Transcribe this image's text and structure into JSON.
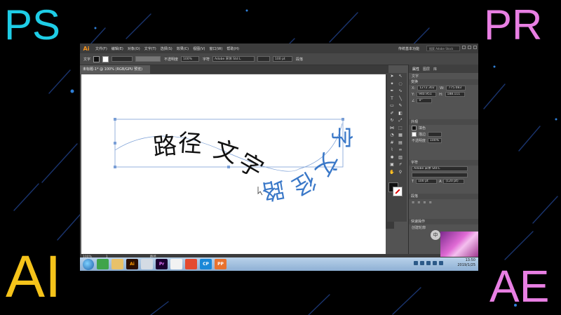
{
  "overlay_labels": {
    "top_left": "PS",
    "top_right": "PR",
    "bottom_left": "AI",
    "bottom_right": "AE"
  },
  "colors": {
    "ps": "#1ecde6",
    "pr": "#e87fe3",
    "ai": "#f5c31a",
    "ae": "#e87fe3",
    "path_text_blue": "#3a78c8"
  },
  "window": {
    "app_logo": "Ai",
    "menus": [
      "文件(F)",
      "编辑(E)",
      "对象(O)",
      "文字(T)",
      "选择(S)",
      "效果(C)",
      "视图(V)",
      "窗口(W)",
      "帮助(H)"
    ],
    "workspace": "传统基本功能",
    "search_placeholder": "搜索 Adobe Stock",
    "controls": {
      "tool_label": "文字",
      "stroke": "不透明度",
      "opacity": "100%",
      "style": "字符",
      "font": "Adobe 宋体 Std L",
      "size": "100 pt",
      "para": "段落"
    },
    "document_tab": "未标题-1* @ 100% (RGB/GPU 预览)",
    "status": {
      "zoom": "100%",
      "page": "1",
      "mode": "路径"
    }
  },
  "canvas": {
    "black_text": [
      "路",
      "径",
      "文",
      "字"
    ],
    "blue_text": [
      "路",
      "径",
      "文",
      "字"
    ]
  },
  "panel": {
    "tabs": [
      "属性",
      "图层",
      "库"
    ],
    "section_transform": "文字",
    "transform_header": "变换",
    "x": "1272.302",
    "y": "940.951",
    "w": "775.083",
    "h": "188.111",
    "angle": "0°",
    "appearance_header": "外观",
    "fill_label": "填色",
    "stroke_label": "描边",
    "opacity_label": "不透明度",
    "opacity_value": "100%",
    "char_header": "字符",
    "font_name": "Adobe 宋体 Std L",
    "font_size": "100 pt",
    "leading": "(120 pt)",
    "para_header": "段落",
    "quick_actions": "快速操作",
    "create_outlines": "创建轮廓"
  },
  "taskbar": {
    "time": "13:50",
    "date": "2019/1/25",
    "apps": [
      "",
      "",
      "Ai",
      "",
      "Pr",
      "",
      "",
      "CP",
      "PP"
    ]
  }
}
